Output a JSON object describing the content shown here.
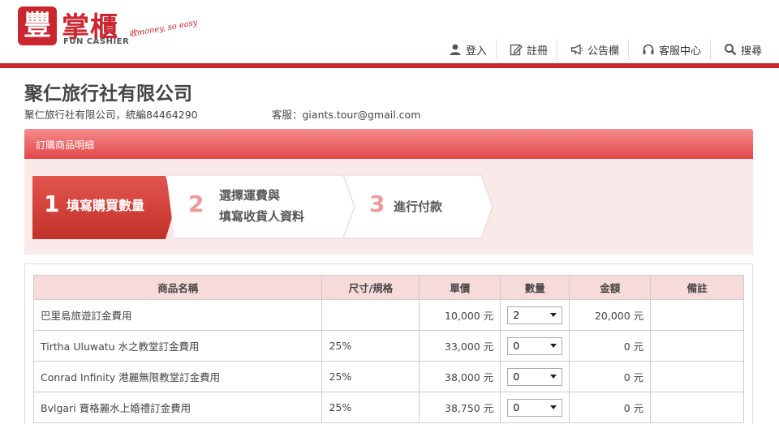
{
  "brand": {
    "mark": "豐",
    "name": "掌櫃",
    "sub": "FUN CASHIER",
    "slogan": "收money, so easy"
  },
  "nav": [
    {
      "label": "登入",
      "icon": "user-icon"
    },
    {
      "label": "註冊",
      "icon": "edit-icon"
    },
    {
      "label": "公告欄",
      "icon": "megaphone-icon"
    },
    {
      "label": "客服中心",
      "icon": "headset-icon"
    },
    {
      "label": "搜尋",
      "icon": "search-icon"
    }
  ],
  "company": {
    "title": "聚仁旅行社有限公司",
    "info": "聚仁旅行社有限公司，統編84464290",
    "service": "客服：giants.tour@gmail.com"
  },
  "section": {
    "title": "訂購商品明細"
  },
  "steps": [
    {
      "number": "1",
      "line1": "填寫購買數量",
      "line2": "",
      "active": true
    },
    {
      "number": "2",
      "line1": "選擇運費與",
      "line2": "填寫收貨人資料",
      "active": false
    },
    {
      "number": "3",
      "line1": "進行付款",
      "line2": "",
      "active": false
    }
  ],
  "colors": {
    "brand_red": "#c9262f",
    "header_gradient_top": "#f58b8b",
    "header_gradient_bottom": "#e2474a",
    "steps_bg": "#f9e9e9",
    "table_header_bg": "#f7dada"
  },
  "table": {
    "headers": [
      "商品名稱",
      "尺寸/規格",
      "單價",
      "數量",
      "金額",
      "備註"
    ],
    "rows": [
      {
        "name": "巴里島旅遊訂金費用",
        "spec": "",
        "price": "10,000 元",
        "qty": "2",
        "amount": "20,000 元",
        "note": ""
      },
      {
        "name": "Tirtha Uluwatu 水之教堂訂金費用",
        "spec": "25%",
        "price": "33,000 元",
        "qty": "0",
        "amount": "0 元",
        "note": ""
      },
      {
        "name": "Conrad Infinity 港麗無限教堂訂金費用",
        "spec": "25%",
        "price": "38,000 元",
        "qty": "0",
        "amount": "0 元",
        "note": ""
      },
      {
        "name": "Bvlgari 寶格麗水上婚禮訂金費用",
        "spec": "25%",
        "price": "38,750 元",
        "qty": "0",
        "amount": "0 元",
        "note": ""
      }
    ]
  }
}
